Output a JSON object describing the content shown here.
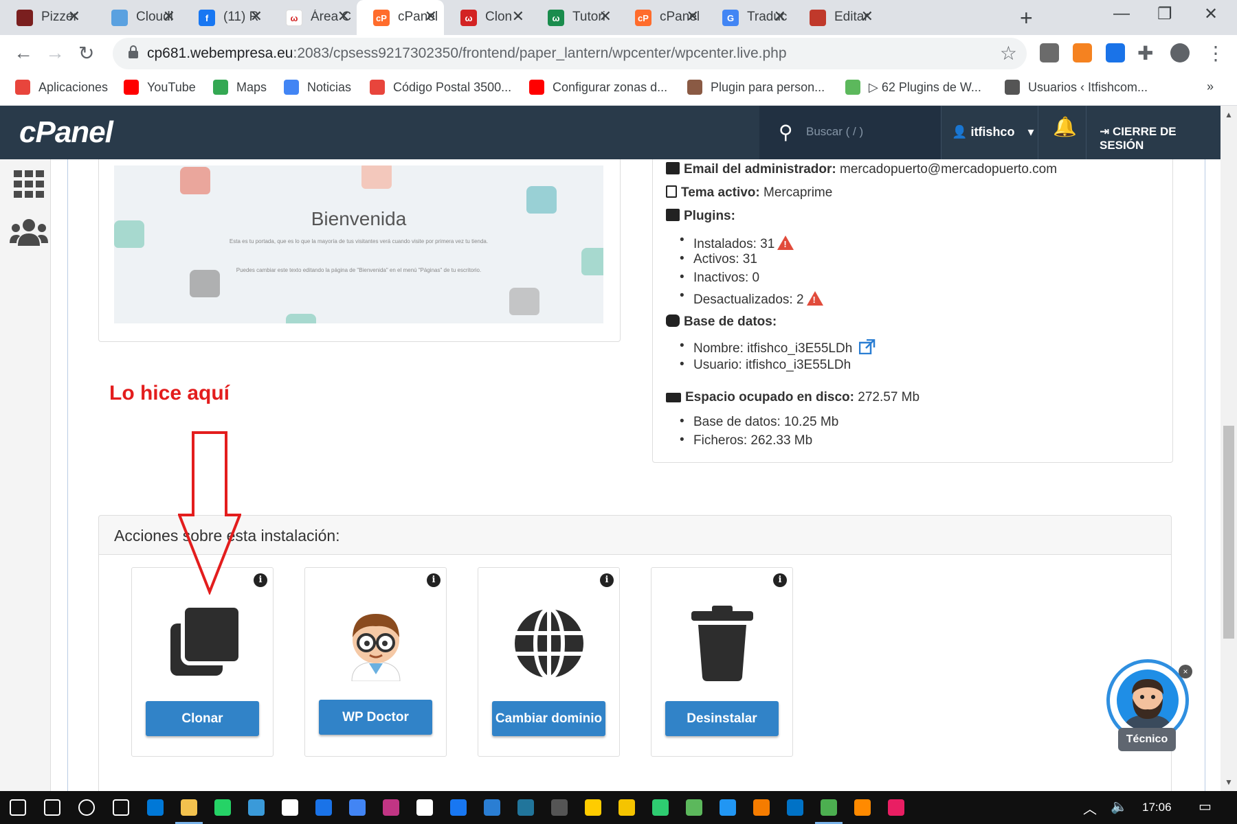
{
  "browser": {
    "tabs": [
      {
        "title": "Pizzer",
        "color": "#7a1f1f",
        "glyph": ""
      },
      {
        "title": "Cloudi",
        "color": "#5aa1e0",
        "glyph": ""
      },
      {
        "title": "(11) R",
        "color": "#1877f2",
        "glyph": "f"
      },
      {
        "title": "Área C",
        "color": "#ffffff",
        "glyph": "ω"
      },
      {
        "title": "cPanel",
        "color": "#ff6c2c",
        "glyph": "cP"
      },
      {
        "title": "Clon -",
        "color": "#d32323",
        "glyph": "ω"
      },
      {
        "title": "Tutori",
        "color": "#1a8c4d",
        "glyph": "ω"
      },
      {
        "title": "cPanel",
        "color": "#ff6c2c",
        "glyph": "cP"
      },
      {
        "title": "Traduc",
        "color": "#4285f4",
        "glyph": "G"
      },
      {
        "title": "Editar",
        "color": "#c0392b",
        "glyph": ""
      }
    ],
    "new_tab": "+",
    "url_host": "cp681.webempresa.eu",
    "url_path": ":2083/cpsess9217302350/frontend/paper_lantern/wpcenter/wpcenter.live.php",
    "bookmarks": [
      {
        "label": "Aplicaciones",
        "color": "#e8453c"
      },
      {
        "label": "YouTube",
        "color": "#ff0000"
      },
      {
        "label": "Maps",
        "color": "#34a853"
      },
      {
        "label": "Noticias",
        "color": "#4285f4"
      },
      {
        "label": "Código Postal 3500...",
        "color": "#e8453c"
      },
      {
        "label": "Configurar zonas d...",
        "color": "#ff0000"
      },
      {
        "label": "Plugin para person...",
        "color": "#8a5a44"
      },
      {
        "label": "▷ 62 Plugins de W...",
        "color": "#5cb85c"
      },
      {
        "label": "Usuarios ‹ Itfishcom...",
        "color": "#555555"
      }
    ],
    "bookmarks_more": "»"
  },
  "cpanel": {
    "logo": "cPanel",
    "search_placeholder": "Buscar ( / )",
    "user": "itfishco",
    "logout": "CIERRE DE SESIÓN"
  },
  "preview": {
    "title": "Bienvenida",
    "line1": "Esta es tu portada, que es lo que la mayoría de tus visitantes verá cuando visite por primera vez tu tienda.",
    "line2": "Puedes cambiar este texto editando la página de \"Bienvenida\" en el menú \"Páginas\" de tu escritorio."
  },
  "info": {
    "admin_email_label": "Email del administrador:",
    "admin_email": "mercadopuerto@mercadopuerto.com",
    "theme_label": "Tema activo:",
    "theme": "Mercaprime",
    "plugins_label": "Plugins:",
    "plugins": {
      "installed": "Instalados: 31",
      "active": "Activos: 31",
      "inactive": "Inactivos: 0",
      "outdated": "Desactualizados: 2"
    },
    "db_label": "Base de datos:",
    "db": {
      "name": "Nombre: itfishco_i3E55LDh",
      "user": "Usuario: itfishco_i3E55LDh"
    },
    "disk_label": "Espacio ocupado en disco:",
    "disk_total": "272.57 Mb",
    "disk": {
      "db": "Base de datos: 10.25 Mb",
      "files": "Ficheros: 262.33 Mb"
    }
  },
  "annotation": "Lo hice aquí",
  "actions": {
    "header": "Acciones sobre esta instalación:",
    "buttons": {
      "clone": "Clonar",
      "doctor": "WP Doctor",
      "domain": "Cambiar dominio",
      "uninstall": "Desinstalar"
    },
    "info_glyph": "i"
  },
  "chat": {
    "label": "Técnico",
    "close": "×"
  },
  "taskbar": {
    "time": "17:06"
  }
}
